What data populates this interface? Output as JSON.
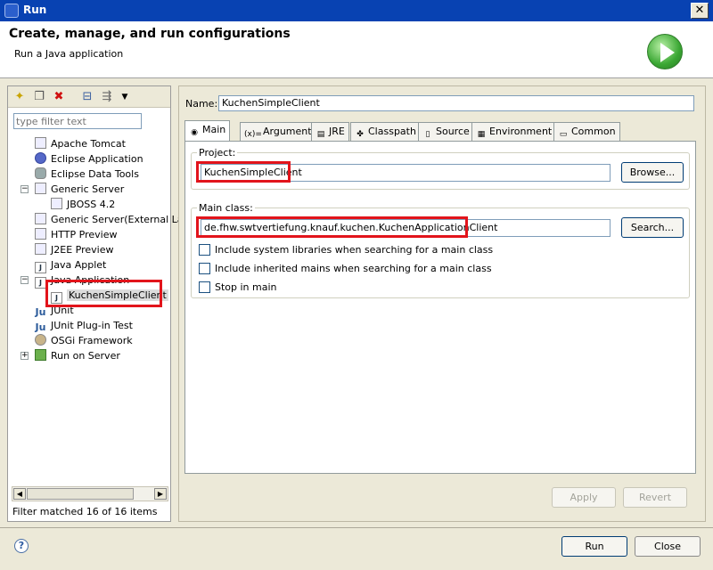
{
  "window": {
    "title": "Run",
    "close_glyph": "✕"
  },
  "header": {
    "title": "Create, manage, and run configurations",
    "subtitle": "Run a Java application"
  },
  "left": {
    "toolbar_icons": [
      "new-config-icon",
      "duplicate-icon",
      "delete-icon",
      "collapse-all-icon",
      "filter-icon",
      "dropdown-arrow-icon"
    ],
    "filter_placeholder": "type filter text",
    "tree": [
      {
        "label": "Apache Tomcat",
        "icon": "doc"
      },
      {
        "label": "Eclipse Application",
        "icon": "circle"
      },
      {
        "label": "Eclipse Data Tools",
        "icon": "db"
      },
      {
        "label": "Generic Server",
        "icon": "doc",
        "expander": "−"
      },
      {
        "label": "JBOSS 4.2",
        "icon": "doc",
        "child": true
      },
      {
        "label": "Generic Server(External La",
        "icon": "doc"
      },
      {
        "label": "HTTP Preview",
        "icon": "doc"
      },
      {
        "label": "J2EE Preview",
        "icon": "doc"
      },
      {
        "label": "Java Applet",
        "icon": "j",
        "glyph": "J"
      },
      {
        "label": "Java Application",
        "icon": "j",
        "glyph": "J",
        "expander": "−"
      },
      {
        "label": "KuchenSimpleClient",
        "icon": "j",
        "glyph": "J",
        "child": true,
        "selected": true
      },
      {
        "label": "JUnit",
        "icon": "ju",
        "glyph": "Ju"
      },
      {
        "label": "JUnit Plug-in Test",
        "icon": "ju",
        "glyph": "Ju"
      },
      {
        "label": "OSGi Framework",
        "icon": "osgi"
      },
      {
        "label": "Run on Server",
        "icon": "srv",
        "expander": "+"
      }
    ],
    "status": "Filter matched 16 of 16 items"
  },
  "right": {
    "name_label": "Name:",
    "name_value": "KuchenSimpleClient",
    "tabs": [
      {
        "label": "Main",
        "icon": "main-tab-icon",
        "glyph": "◉"
      },
      {
        "label": "Arguments",
        "icon": "arguments-tab-icon",
        "glyph": "(x)="
      },
      {
        "label": "JRE",
        "icon": "jre-tab-icon",
        "glyph": "▤"
      },
      {
        "label": "Classpath",
        "icon": "classpath-tab-icon",
        "glyph": "✤"
      },
      {
        "label": "Source",
        "icon": "source-tab-icon",
        "glyph": "▯"
      },
      {
        "label": "Environment",
        "icon": "environment-tab-icon",
        "glyph": "▦"
      },
      {
        "label": "Common",
        "icon": "common-tab-icon",
        "glyph": "▭"
      }
    ],
    "project": {
      "label": "Project:",
      "value": "KuchenSimpleClient",
      "browse": "Browse..."
    },
    "main_class": {
      "label": "Main class:",
      "value": "de.fhw.swtvertiefung.knauf.kuchen.KuchenApplicationClient",
      "search": "Search..."
    },
    "checkboxes": [
      {
        "label": "Include system libraries when searching for a main class",
        "checked": false
      },
      {
        "label": "Include inherited mains when searching for a main class",
        "checked": false
      },
      {
        "label": "Stop in main",
        "checked": false
      }
    ],
    "apply": "Apply",
    "revert": "Revert"
  },
  "footer": {
    "run": "Run",
    "close": "Close",
    "help_glyph": "?"
  }
}
